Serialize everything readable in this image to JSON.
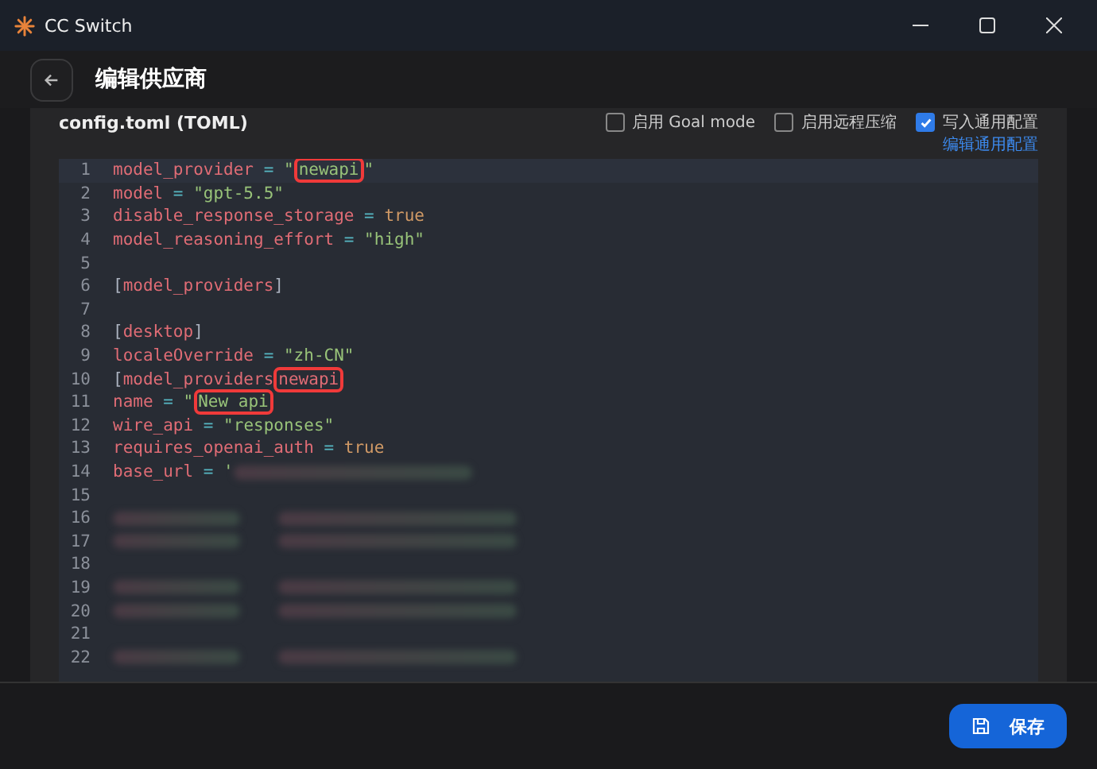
{
  "window": {
    "title": "CC Switch"
  },
  "header": {
    "title": "编辑供应商"
  },
  "config": {
    "title": "config.toml (TOML)",
    "options": [
      {
        "label": "启用 Goal mode",
        "checked": false
      },
      {
        "label": "启用远程压缩",
        "checked": false
      },
      {
        "label": "写入通用配置",
        "checked": true
      }
    ],
    "link": "编辑通用配置"
  },
  "editor": {
    "lines": [
      {
        "number": "1",
        "segments": [
          {
            "kind": "key",
            "text": "model_provider"
          },
          {
            "kind": "op",
            "text": " = "
          },
          {
            "kind": "string",
            "text": "\""
          },
          {
            "kind": "string",
            "text": "newapi",
            "highlighted": true
          },
          {
            "kind": "string",
            "text": "\""
          }
        ]
      },
      {
        "number": "2",
        "segments": [
          {
            "kind": "key",
            "text": "model"
          },
          {
            "kind": "op",
            "text": " = "
          },
          {
            "kind": "string",
            "text": "\"gpt-5.5\""
          }
        ]
      },
      {
        "number": "3",
        "segments": [
          {
            "kind": "key",
            "text": "disable_response_storage"
          },
          {
            "kind": "op",
            "text": " = "
          },
          {
            "kind": "bool",
            "text": "true"
          }
        ]
      },
      {
        "number": "4",
        "segments": [
          {
            "kind": "key",
            "text": "model_reasoning_effort"
          },
          {
            "kind": "op",
            "text": " = "
          },
          {
            "kind": "string",
            "text": "\"high\""
          }
        ]
      },
      {
        "number": "5"
      },
      {
        "number": "6",
        "segments": [
          {
            "kind": "punct",
            "text": "["
          },
          {
            "kind": "section",
            "text": "model_providers"
          },
          {
            "kind": "punct",
            "text": "]"
          }
        ]
      },
      {
        "number": "7"
      },
      {
        "number": "8",
        "segments": [
          {
            "kind": "punct",
            "text": "["
          },
          {
            "kind": "section",
            "text": "desktop"
          },
          {
            "kind": "punct",
            "text": "]"
          }
        ]
      },
      {
        "number": "9",
        "segments": [
          {
            "kind": "key",
            "text": "localeOverride"
          },
          {
            "kind": "op",
            "text": " = "
          },
          {
            "kind": "string",
            "text": "\"zh-CN\""
          }
        ]
      },
      {
        "number": "10",
        "segments": [
          {
            "kind": "punct",
            "text": "["
          },
          {
            "kind": "section",
            "text": "model_providers"
          },
          {
            "kind": "section",
            "text": "newapi",
            "highlighted": true
          }
        ]
      },
      {
        "number": "11",
        "segments": [
          {
            "kind": "key",
            "text": "name"
          },
          {
            "kind": "op",
            "text": " = "
          },
          {
            "kind": "string",
            "text": "\""
          },
          {
            "kind": "string",
            "text": "New api",
            "highlighted": true
          }
        ]
      },
      {
        "number": "12",
        "segments": [
          {
            "kind": "key",
            "text": "wire_api"
          },
          {
            "kind": "op",
            "text": " = "
          },
          {
            "kind": "string",
            "text": "\"responses\""
          }
        ]
      },
      {
        "number": "13",
        "segments": [
          {
            "kind": "key",
            "text": "requires_openai_auth"
          },
          {
            "kind": "op",
            "text": " = "
          },
          {
            "kind": "bool",
            "text": "true"
          }
        ]
      },
      {
        "number": "14",
        "segments": [
          {
            "kind": "key",
            "text": "base_url"
          },
          {
            "kind": "op",
            "text": " = "
          },
          {
            "kind": "string",
            "text": "'"
          },
          {
            "kind": "redacted"
          }
        ]
      },
      {
        "number": "15"
      },
      {
        "number": "16",
        "segments": [
          {
            "kind": "redacted"
          },
          {
            "kind": "redacted"
          }
        ]
      },
      {
        "number": "17",
        "segments": [
          {
            "kind": "redacted"
          },
          {
            "kind": "redacted"
          }
        ]
      },
      {
        "number": "18"
      },
      {
        "number": "19",
        "segments": [
          {
            "kind": "redacted"
          },
          {
            "kind": "redacted"
          }
        ]
      },
      {
        "number": "20",
        "segments": [
          {
            "kind": "redacted"
          },
          {
            "kind": "redacted"
          }
        ]
      },
      {
        "number": "21"
      },
      {
        "number": "22",
        "segments": [
          {
            "kind": "redacted"
          },
          {
            "kind": "redacted"
          }
        ]
      }
    ]
  },
  "footer": {
    "save_button": "保存"
  }
}
